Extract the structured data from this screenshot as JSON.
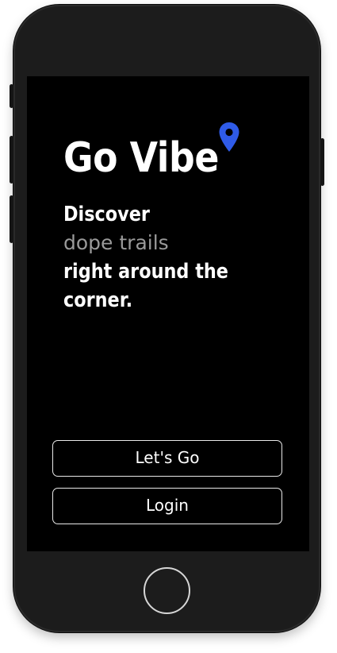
{
  "app": {
    "title": "Go Vibe"
  },
  "tagline": {
    "line1": "Discover",
    "line2": "dope trails",
    "line3": "right around the",
    "line4": "corner."
  },
  "actions": {
    "primary_label": "Let's Go",
    "secondary_label": "Login"
  },
  "icons": {
    "pin": "location-pin-icon"
  },
  "colors": {
    "screen_background": "#000000",
    "text_primary": "#ffffff",
    "text_muted": "#9a9a9a",
    "accent_pin": "#2f5be8",
    "button_border": "#e9e9e9",
    "device_frame": "#1c1c1c"
  }
}
